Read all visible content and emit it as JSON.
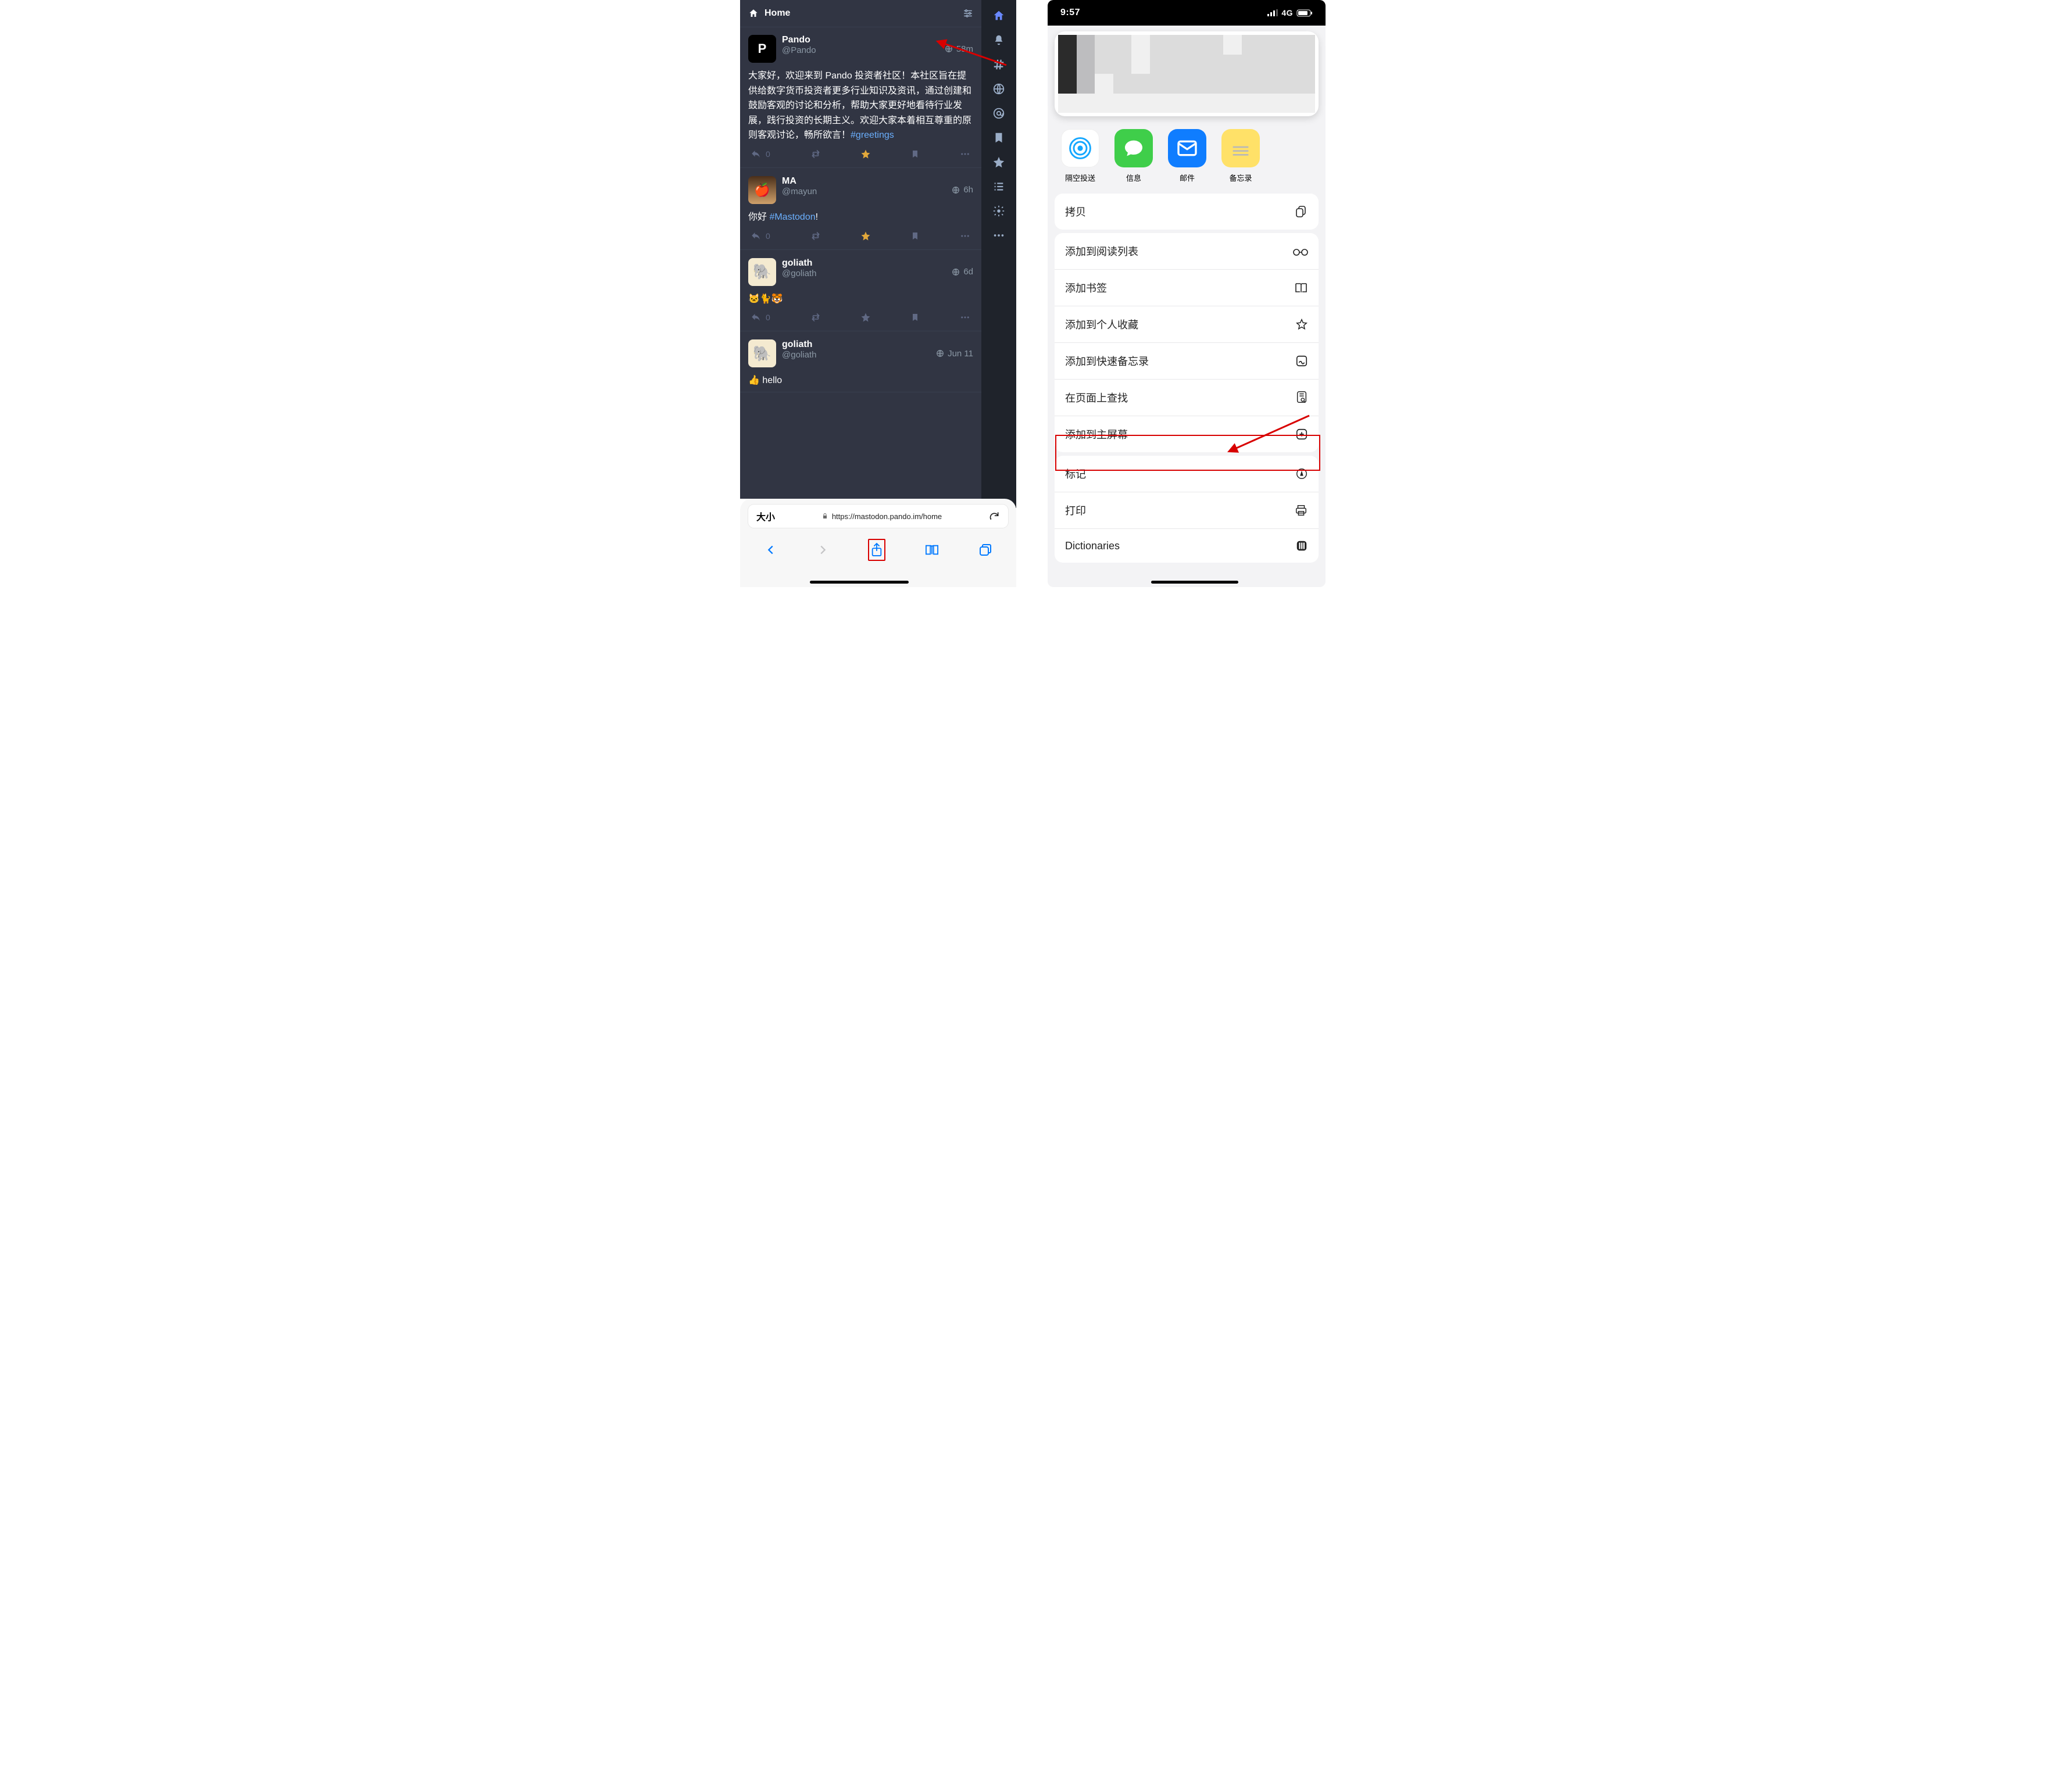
{
  "left": {
    "header": {
      "title": "Home"
    },
    "sidebar_icons": [
      "home",
      "bell",
      "hash",
      "globe",
      "at",
      "bookmark",
      "star",
      "list",
      "gear",
      "dots"
    ],
    "posts": [
      {
        "avatar_letter": "P",
        "display_name": "Pando",
        "handle": "@Pando",
        "time": "58m",
        "body_prefix": "大家好，欢迎来到 Pando 投资者社区！本社区旨在提供给数字货币投资者更多行业知识及资讯，通过创建和鼓励客观的讨论和分析，帮助大家更好地看待行业发展，践行投资的长期主义。欢迎大家本着相互尊重的原则客观讨论，畅所欲言！",
        "hashtag": "#greetings",
        "reply_count": "0",
        "favorited": true
      },
      {
        "avatar_kind": "apple",
        "display_name": "MA",
        "handle": "@mayun",
        "time": "6h",
        "body_prefix": "你好 ",
        "hashtag": "#Mastodon",
        "body_suffix": "!",
        "reply_count": "0",
        "favorited": true
      },
      {
        "avatar_kind": "ele",
        "display_name": "goliath",
        "handle": "@goliath",
        "time": "6d",
        "body_prefix": "🐱🐈🐯",
        "reply_count": "0",
        "favorited": false
      },
      {
        "avatar_kind": "ele",
        "display_name": "goliath",
        "handle": "@goliath",
        "time": "Jun 11",
        "body_prefix": "👍 hello"
      }
    ],
    "safari": {
      "aa": "大小",
      "url": "https://mastodon.pando.im/home"
    }
  },
  "right": {
    "status": {
      "time": "9:57",
      "signal": "4G"
    },
    "share_apps": [
      {
        "name": "隔空投送",
        "kind": "airdrop"
      },
      {
        "name": "信息",
        "kind": "msg"
      },
      {
        "name": "邮件",
        "kind": "mail"
      },
      {
        "name": "备忘录",
        "kind": "note"
      }
    ],
    "copy": {
      "label": "拷贝"
    },
    "list": [
      {
        "label": "添加到阅读列表",
        "icon": "glasses"
      },
      {
        "label": "添加书签",
        "icon": "book"
      },
      {
        "label": "添加到个人收藏",
        "icon": "star"
      },
      {
        "label": "添加到快速备忘录",
        "icon": "quicknote"
      },
      {
        "label": "在页面上查找",
        "icon": "find"
      },
      {
        "label": "添加到主屏幕",
        "icon": "addhome"
      }
    ],
    "list2": [
      {
        "label": "标记",
        "icon": "markup"
      },
      {
        "label": "打印",
        "icon": "print"
      },
      {
        "label": "Dictionaries",
        "icon": "dict"
      }
    ]
  }
}
